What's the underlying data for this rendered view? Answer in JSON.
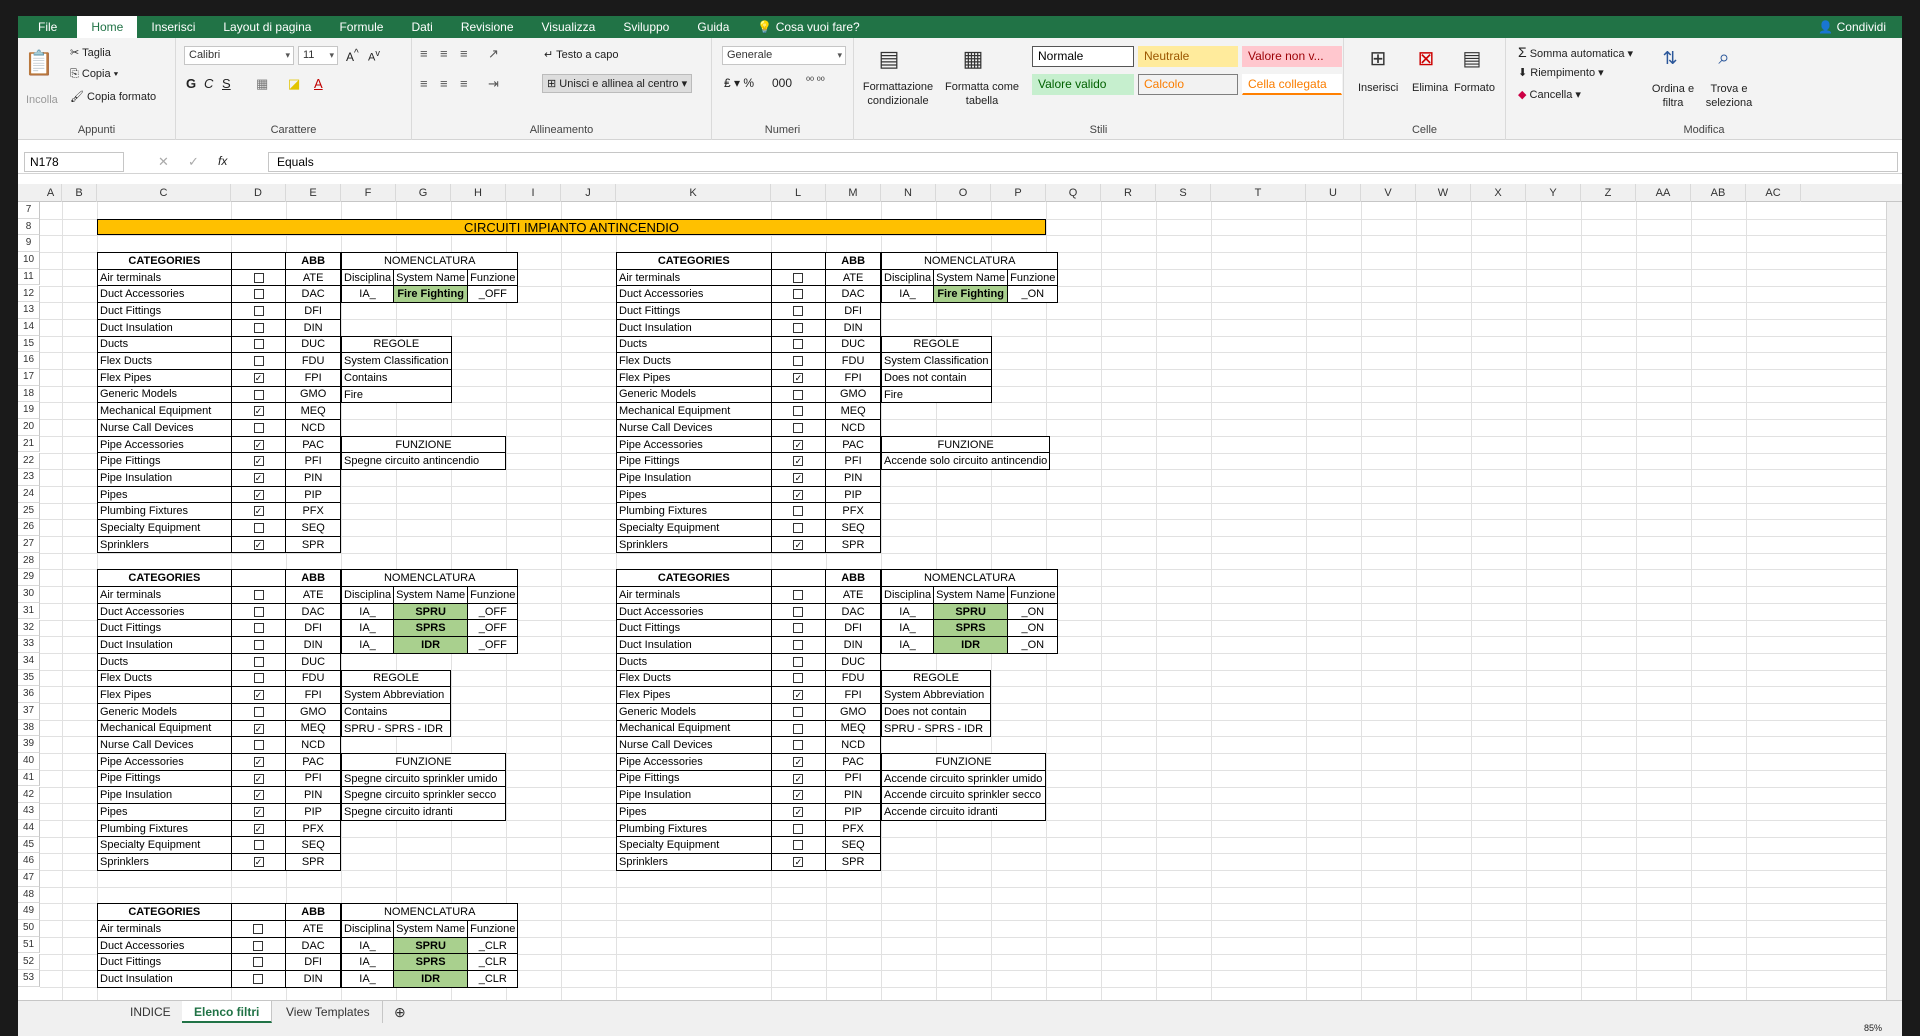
{
  "ribbon_tabs": [
    "File",
    "Home",
    "Inserisci",
    "Layout di pagina",
    "Formule",
    "Dati",
    "Revisione",
    "Visualizza",
    "Sviluppo",
    "Guida"
  ],
  "tell_me": "Cosa vuoi fare?",
  "share": "Condividi",
  "clipboard": {
    "paste": "Incolla",
    "cut": "Taglia",
    "copy": "Copia",
    "format_painter": "Copia formato",
    "label": "Appunti"
  },
  "font": {
    "name": "Calibri",
    "size": "11",
    "label": "Carattere"
  },
  "alignment": {
    "wrap": "Testo a capo",
    "merge": "Unisci e allinea al centro",
    "label": "Allineamento"
  },
  "number": {
    "format": "Generale",
    "label": "Numeri"
  },
  "styles": {
    "cond": "Formattazione condizionale",
    "table": "Formatta come tabella",
    "label": "Stili",
    "items": [
      "Normale",
      "Neutrale",
      "Valore non v...",
      "Valore valido",
      "Calcolo",
      "Cella collegata"
    ]
  },
  "cells": {
    "insert": "Inserisci",
    "delete": "Elimina",
    "format": "Formato",
    "label": "Celle"
  },
  "edit": {
    "autosum": "Somma automatica",
    "fill": "Riempimento",
    "clear": "Cancella",
    "sort": "Ordina e filtra",
    "find": "Trova e seleziona",
    "label": "Modifica"
  },
  "formula_bar": {
    "name_box": "N178",
    "fx": "fx",
    "content": "Equals"
  },
  "columns": [
    "A",
    "B",
    "C",
    "D",
    "E",
    "F",
    "G",
    "H",
    "I",
    "J",
    "K",
    "L",
    "M",
    "N",
    "O",
    "P",
    "Q",
    "R",
    "S",
    "T",
    "U",
    "V",
    "W",
    "X",
    "Y",
    "Z",
    "AA",
    "AB",
    "AC"
  ],
  "rows": [
    "7",
    "8",
    "9",
    "10",
    "11",
    "12",
    "13",
    "14",
    "15",
    "16",
    "17",
    "18",
    "19",
    "20",
    "21",
    "22",
    "23",
    "24",
    "25",
    "26",
    "27",
    "28",
    "29",
    "30",
    "31",
    "32",
    "33",
    "34",
    "35",
    "36",
    "37",
    "38",
    "39",
    "40",
    "41",
    "42",
    "43",
    "44",
    "45",
    "46",
    "47",
    "48",
    "49",
    "50",
    "51",
    "52",
    "53"
  ],
  "banner": "CIRCUITI IMPIANTO ANTINCENDIO",
  "cat_header": {
    "cat": "CATEGORIES",
    "abb": "ABB"
  },
  "categories": [
    [
      "Air terminals",
      "ATE"
    ],
    [
      "Duct Accessories",
      "DAC"
    ],
    [
      "Duct Fittings",
      "DFI"
    ],
    [
      "Duct Insulation",
      "DIN"
    ],
    [
      "Ducts",
      "DUC"
    ],
    [
      "Flex Ducts",
      "FDU"
    ],
    [
      "Flex Pipes",
      "FPI"
    ],
    [
      "Generic Models",
      "GMO"
    ],
    [
      "Mechanical Equipment",
      "MEQ"
    ],
    [
      "Nurse Call Devices",
      "NCD"
    ],
    [
      "Pipe Accessories",
      "PAC"
    ],
    [
      "Pipe Fittings",
      "PFI"
    ],
    [
      "Pipe Insulation",
      "PIN"
    ],
    [
      "Pipes",
      "PIP"
    ],
    [
      "Plumbing Fixtures",
      "PFX"
    ],
    [
      "Specialty Equipment",
      "SEQ"
    ],
    [
      "Sprinklers",
      "SPR"
    ]
  ],
  "checks_1": [
    0,
    0,
    0,
    0,
    0,
    0,
    1,
    0,
    1,
    0,
    1,
    1,
    1,
    1,
    1,
    0,
    1
  ],
  "checks_2": [
    0,
    0,
    0,
    0,
    0,
    0,
    1,
    0,
    0,
    0,
    1,
    1,
    1,
    1,
    0,
    0,
    1
  ],
  "checks_1b": [
    0,
    0,
    0,
    0,
    0,
    0,
    1,
    0,
    1,
    0,
    1,
    1,
    1,
    1,
    1,
    0,
    1
  ],
  "checks_2b": [
    0,
    0,
    0,
    0,
    0,
    0,
    1,
    0,
    0,
    0,
    1,
    1,
    1,
    1,
    0,
    0,
    1
  ],
  "nom_header": {
    "title": "NOMENCLATURA",
    "c1": "Disciplina",
    "c2": "System Name",
    "c3": "Funzione"
  },
  "nom_1": [
    [
      "IA_",
      "Fire Fighting",
      "_OFF"
    ]
  ],
  "nom_1b": [
    [
      "IA_",
      "Fire Fighting",
      "_ON"
    ]
  ],
  "nom_2": [
    [
      "IA_",
      "SPRU",
      "_OFF"
    ],
    [
      "IA_",
      "SPRS",
      "_OFF"
    ],
    [
      "IA_",
      "IDR",
      "_OFF"
    ]
  ],
  "nom_2b": [
    [
      "IA_",
      "SPRU",
      "_ON"
    ],
    [
      "IA_",
      "SPRS",
      "_ON"
    ],
    [
      "IA_",
      "IDR",
      "_ON"
    ]
  ],
  "nom_3": [
    [
      "IA_",
      "SPRU",
      "_CLR"
    ],
    [
      "IA_",
      "SPRS",
      "_CLR"
    ],
    [
      "IA_",
      "IDR",
      "_CLR"
    ]
  ],
  "rules_title": "REGOLE",
  "rules_1": [
    "System Classification",
    "Contains",
    "Fire"
  ],
  "rules_1b": [
    "System Classification",
    "Does not contain",
    "Fire"
  ],
  "rules_2": [
    "System Abbreviation",
    "Contains",
    "SPRU - SPRS - IDR"
  ],
  "rules_2b": [
    "System Abbreviation",
    "Does not contain",
    "SPRU - SPRS - IDR"
  ],
  "func_title": "FUNZIONE",
  "func_1": [
    "Spegne circuito antincendio"
  ],
  "func_1b": [
    "Accende solo circuito antincendio"
  ],
  "func_2": [
    "Spegne circuito sprinkler umido",
    "Spegne circuito sprinkler secco",
    "Spegne circuito idranti"
  ],
  "func_2b": [
    "Accende circuito sprinkler umido",
    "Accende circuito sprinkler secco",
    "Accende circuito idranti"
  ],
  "sheet_tabs": [
    "INDICE",
    "Elenco filtri",
    "View Templates"
  ],
  "zoom": "85%"
}
